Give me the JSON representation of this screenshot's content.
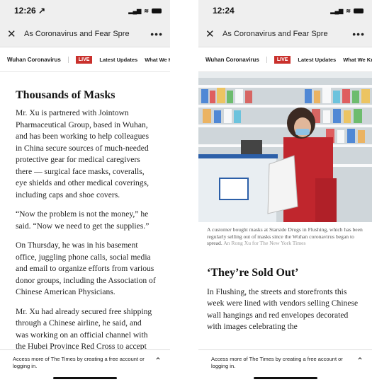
{
  "left": {
    "status": {
      "time": "12:26 ↗"
    },
    "nav": {
      "title": "As Coronavirus and Fear Spre"
    },
    "subnav": {
      "section": "Wuhan Coronavirus",
      "live": "LIVE",
      "latest": "Latest Updates",
      "what": "What We Know"
    },
    "heading": "Thousands of Masks",
    "paragraphs": [
      "Mr. Xu is partnered with Jointown Pharmaceutical Group, based in Wuhan, and has been working to help colleagues in China secure sources of much-needed protective gear for medical caregivers there — surgical face masks, coveralls, eye shields and other medical coverings, including caps and shoe covers.",
      "“Now the problem is not the money,” he said. “Now we need to get the supplies.”",
      "On Thursday, he was in his basement office, juggling phone calls, social media and email to organize efforts from various donor groups, including the Association of Chinese American Physicians.",
      "Mr. Xu had already secured free shipping through a Chinese airline, he said, and was working on an official channel with the Hubei Province Red Cross to accept"
    ],
    "bottom": {
      "message": "Access more of The Times by creating a free account or logging in."
    }
  },
  "right": {
    "status": {
      "time": "12:24"
    },
    "nav": {
      "title": "As Coronavirus and Fear Spre"
    },
    "subnav": {
      "section": "Wuhan Coronavirus",
      "live": "LIVE",
      "latest": "Latest Updates",
      "what": "What We Know"
    },
    "caption": "A customer bought masks at Starside Drugs in Flushing, which has been regularly selling out of masks since the Wuhan coronavirus began to spread.",
    "credit": "An Rong Xu for The New York Times",
    "heading": "‘They’re Sold Out’",
    "paragraph": "In Flushing, the streets and storefronts this week were lined with vendors selling Chinese wall hangings and red envelopes decorated with images celebrating the",
    "bottom": {
      "message": "Access more of The Times by creating a free account or logging in."
    }
  },
  "icons": {
    "close": "✕",
    "more": "•••",
    "chevron": "⌃",
    "signal": "▂▄▆",
    "wifi": "≋"
  }
}
